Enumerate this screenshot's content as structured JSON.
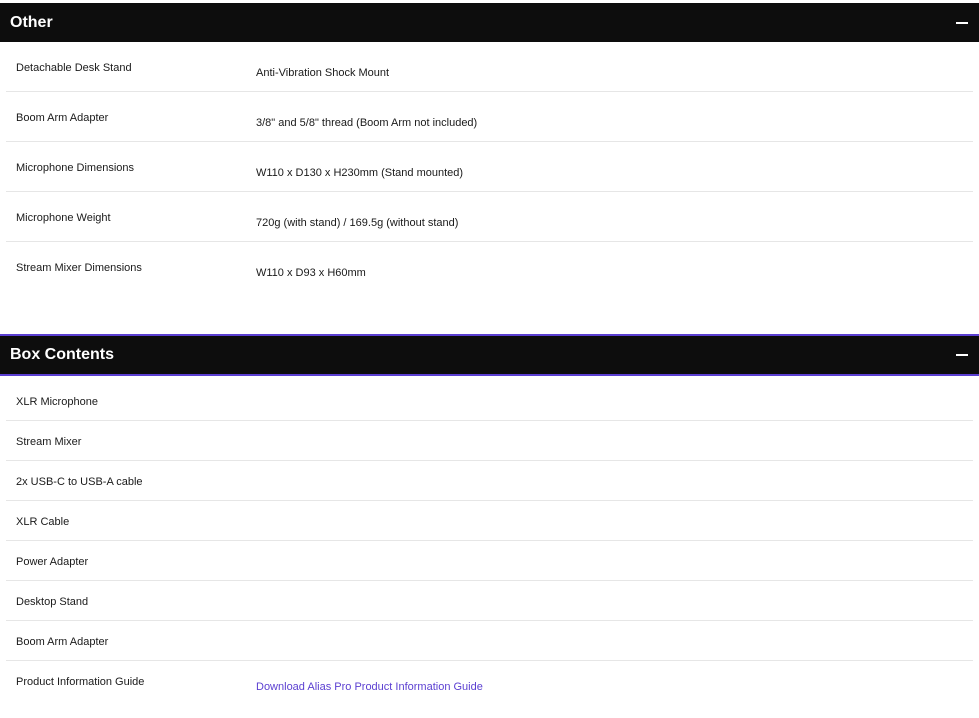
{
  "sections": [
    {
      "title": "Other",
      "collapse_icon": "minus-icon",
      "rows": [
        {
          "label": "Detachable Desk Stand",
          "value": "Anti-Vibration Shock Mount"
        },
        {
          "label": "Boom Arm Adapter",
          "value": "3/8\" and 5/8\" thread (Boom Arm not included)"
        },
        {
          "label": "Microphone Dimensions",
          "value": "W110 x D130 x H230mm (Stand mounted)"
        },
        {
          "label": "Microphone Weight",
          "value": "720g (with stand) / 169.5g (without stand)"
        },
        {
          "label": "Stream Mixer Dimensions",
          "value": "W110 x D93 x H60mm"
        }
      ]
    },
    {
      "title": "Box Contents",
      "collapse_icon": "minus-icon",
      "rows": [
        {
          "label": "XLR Microphone",
          "value": ""
        },
        {
          "label": "Stream Mixer",
          "value": ""
        },
        {
          "label": "2x USB-C to USB-A cable",
          "value": ""
        },
        {
          "label": "XLR Cable",
          "value": ""
        },
        {
          "label": "Power Adapter",
          "value": ""
        },
        {
          "label": "Desktop Stand",
          "value": ""
        },
        {
          "label": "Boom Arm Adapter",
          "value": ""
        },
        {
          "label": "Product Information Guide",
          "value": "Download Alias Pro Product Information Guide"
        }
      ]
    }
  ],
  "colors": {
    "header_bg": "#0d0d0d",
    "accent": "#5b3fd1",
    "divider": "#e6e6e6"
  }
}
